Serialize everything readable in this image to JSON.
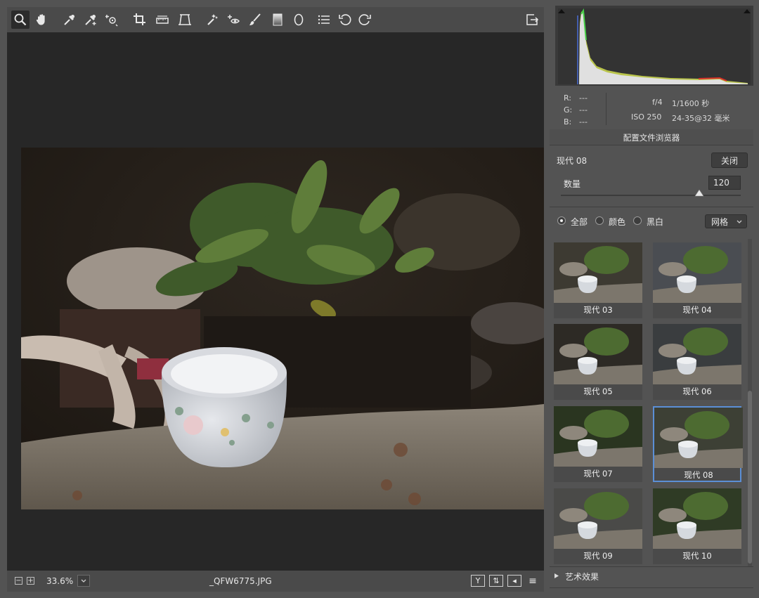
{
  "toolbar": {
    "tools": [
      "zoom-icon",
      "hand-icon",
      "white-balance-icon",
      "color-sampler-icon",
      "targeted-adjust-icon",
      "crop-icon",
      "straighten-icon",
      "transform-icon",
      "spot-removal-icon",
      "red-eye-icon",
      "adjustment-brush-icon",
      "graduated-filter-icon",
      "radial-filter-icon",
      "presets-list-icon",
      "rotate-left-icon",
      "rotate-right-icon"
    ],
    "export_icon": "open-in-photoshop-icon"
  },
  "statusbar": {
    "zoom_minus": "−",
    "zoom_plus": "+",
    "zoom_level": "33.6%",
    "filename": "_QFW6775.JPG",
    "icons": [
      "Y",
      "⇅",
      "◂",
      "≡"
    ]
  },
  "info": {
    "r_label": "R:",
    "r_value": "---",
    "g_label": "G:",
    "g_value": "---",
    "b_label": "B:",
    "b_value": "---",
    "aperture": "f/4",
    "shutter": "1/1600 秒",
    "iso": "ISO 250",
    "lens": "24-35@32 毫米"
  },
  "profile_browser": {
    "title": "配置文件浏览器",
    "current_profile": "现代 08",
    "close_label": "关闭",
    "amount_label": "数量",
    "amount_value": "120",
    "amount_fraction": 0.77,
    "filters": [
      {
        "label": "全部",
        "selected": true
      },
      {
        "label": "颜色",
        "selected": false
      },
      {
        "label": "黑白",
        "selected": false
      }
    ],
    "view_label": "网格",
    "thumbnails": [
      {
        "label": "现代 03",
        "selected": false
      },
      {
        "label": "现代 04",
        "selected": false
      },
      {
        "label": "现代 05",
        "selected": false
      },
      {
        "label": "现代 06",
        "selected": false
      },
      {
        "label": "现代 07",
        "selected": false
      },
      {
        "label": "现代 08",
        "selected": true
      },
      {
        "label": "现代 09",
        "selected": false
      },
      {
        "label": "现代 10",
        "selected": false
      }
    ],
    "next_group": "艺术效果"
  },
  "colors": {
    "selection": "#5b8fd6",
    "panel_bg": "#535353",
    "canvas_bg": "#272727"
  }
}
